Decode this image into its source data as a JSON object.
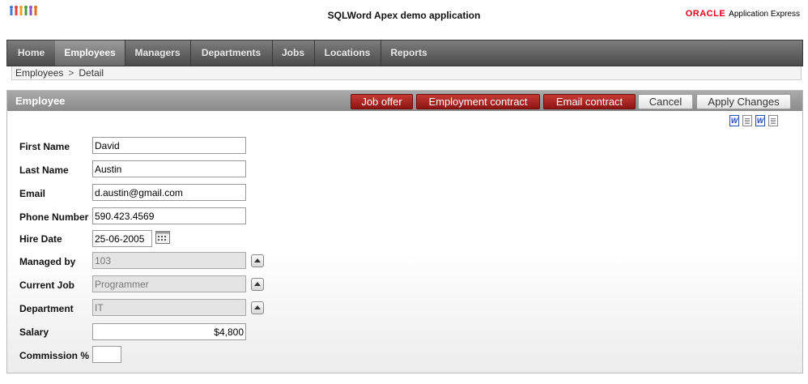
{
  "header": {
    "app_title": "SQLWord Apex demo application",
    "oracle_brand": "ORACLE",
    "oracle_product": "Application Express"
  },
  "tabs": [
    {
      "label": "Home",
      "active": false
    },
    {
      "label": "Employees",
      "active": true
    },
    {
      "label": "Managers",
      "active": false
    },
    {
      "label": "Departments",
      "active": false
    },
    {
      "label": "Jobs",
      "active": false
    },
    {
      "label": "Locations",
      "active": false
    },
    {
      "label": "Reports",
      "active": false
    }
  ],
  "breadcrumb": {
    "parent": "Employees",
    "separator": ">",
    "current": "Detail"
  },
  "region": {
    "title": "Employee",
    "buttons": {
      "job_offer": "Job offer",
      "employment_contract": "Employment contract",
      "email_contract": "Email contract",
      "cancel": "Cancel",
      "apply_changes": "Apply Changes"
    },
    "doc_icons": [
      "word-icon",
      "text-file-icon",
      "word-icon",
      "text-file-icon"
    ]
  },
  "form": {
    "first_name": {
      "label": "First Name",
      "value": "David"
    },
    "last_name": {
      "label": "Last Name",
      "value": "Austin"
    },
    "email": {
      "label": "Email",
      "value": "d.austin@gmail.com"
    },
    "phone": {
      "label": "Phone Number",
      "value": "590.423.4569"
    },
    "hire_date": {
      "label": "Hire Date",
      "value": "25-06-2005"
    },
    "managed_by": {
      "label": "Managed by",
      "value": "103"
    },
    "current_job": {
      "label": "Current Job",
      "value": "Programmer"
    },
    "department": {
      "label": "Department",
      "value": "IT"
    },
    "salary": {
      "label": "Salary",
      "value": "$4,800"
    },
    "commission": {
      "label": "Commission %",
      "value": ""
    }
  },
  "colors": {
    "accent_red": "#a8201c",
    "tab_bar": "#5a5a5a",
    "oracle_red": "#e0001a"
  }
}
